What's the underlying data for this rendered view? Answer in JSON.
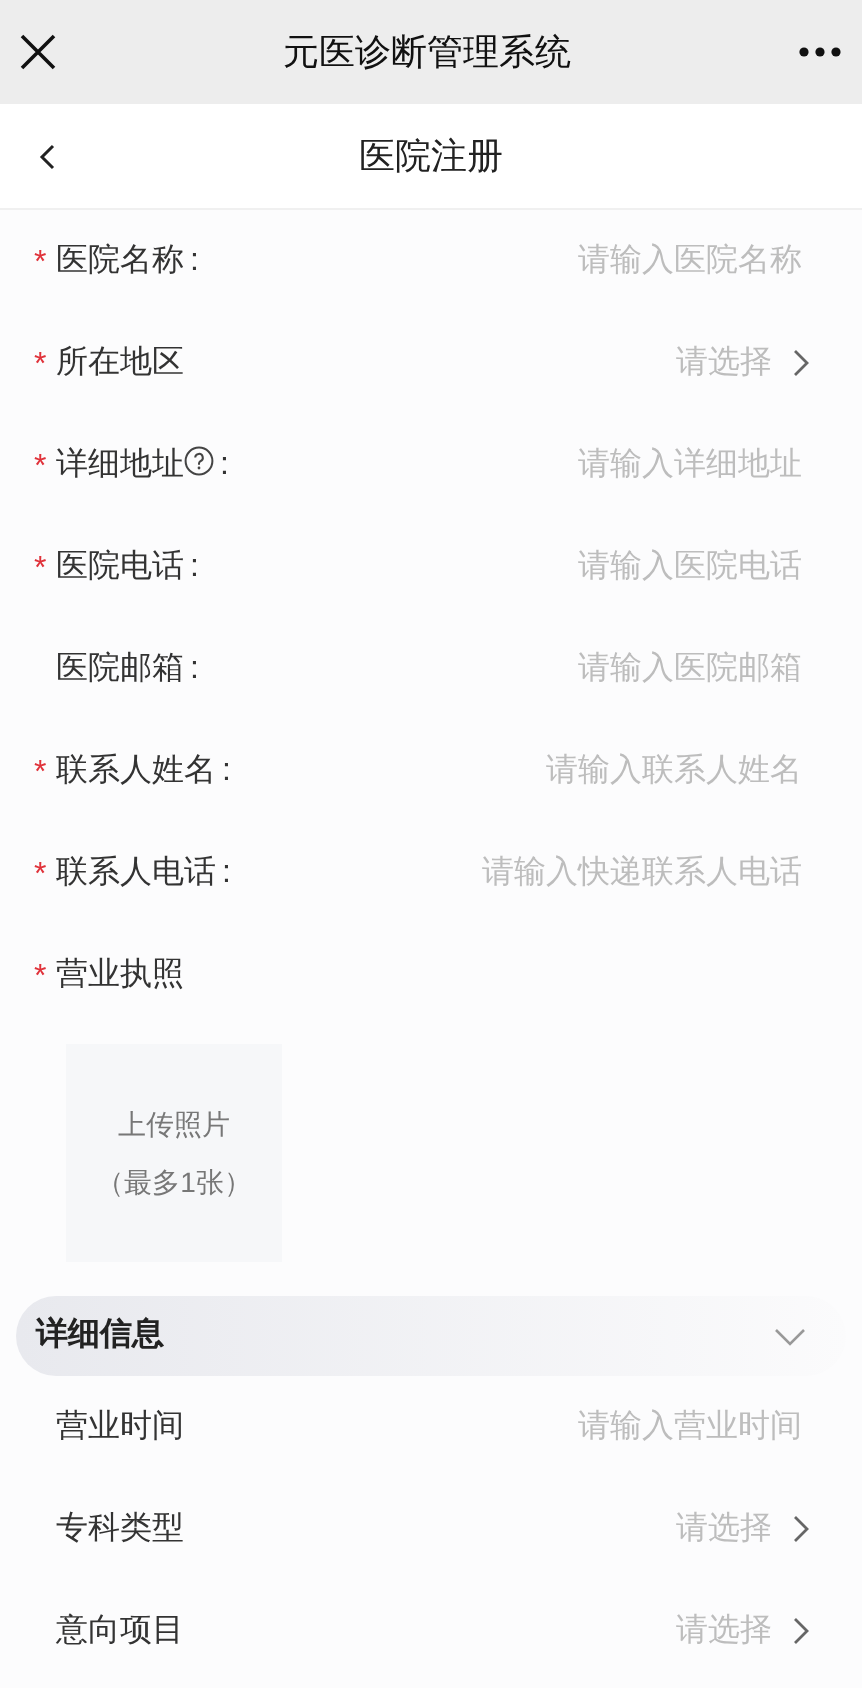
{
  "window": {
    "title": "元医诊断管理系统"
  },
  "header": {
    "title": "医院注册"
  },
  "fields": [
    {
      "kind": "input",
      "mark": "*",
      "label": "医院名称",
      "colon": ":",
      "placeholder": "请输入医院名称"
    },
    {
      "kind": "select",
      "mark": "*",
      "label": "所在地区",
      "placeholder": "请选择"
    },
    {
      "kind": "input",
      "mark": "*",
      "label": "详细地址",
      "help": true,
      "colon": ":",
      "placeholder": "请输入详细地址"
    },
    {
      "kind": "input",
      "mark": "*",
      "label": "医院电话",
      "colon": ":",
      "placeholder": "请输入医院电话"
    },
    {
      "kind": "input",
      "label": "医院邮箱",
      "colon": ":",
      "placeholder": "请输入医院邮箱"
    },
    {
      "kind": "input",
      "mark": "*",
      "label": "联系人姓名",
      "colon": ":",
      "placeholder": "请输入联系人姓名"
    },
    {
      "kind": "input",
      "mark": "*",
      "label": "联系人电话",
      "colon": ":",
      "placeholder": "请输入快递联系人电话"
    },
    {
      "kind": "upload",
      "mark": "*",
      "label": "营业执照",
      "button": "上传照片",
      "hint": "（最多1张）"
    }
  ],
  "details": {
    "title": "详细信息",
    "expanded": true,
    "fields": [
      {
        "kind": "input",
        "label": "营业时间",
        "placeholder": "请输入营业时间"
      },
      {
        "kind": "select",
        "label": "专科类型",
        "placeholder": "请选择"
      },
      {
        "kind": "select",
        "label": "意向项目",
        "placeholder": "请选择"
      }
    ]
  }
}
